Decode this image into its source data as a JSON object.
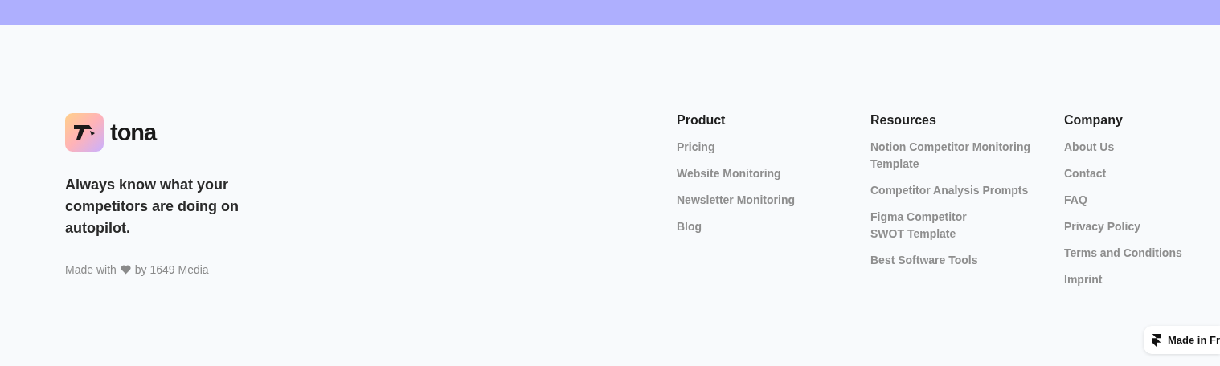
{
  "brand": {
    "name": "tona"
  },
  "tagline": "Always know what your competitors are doing on autopilot.",
  "credit": {
    "before": "Made with",
    "after": "by 1649 Media"
  },
  "columns": [
    {
      "title": "Product",
      "links": [
        "Pricing",
        "Website Monitoring",
        "Newsletter Monitoring",
        "Blog"
      ]
    },
    {
      "title": "Resources",
      "links": [
        "Notion Competitor Monitoring Template",
        "Competitor Analysis Prompts",
        "Figma Competitor\nSWOT Template",
        "Best Software Tools"
      ]
    },
    {
      "title": "Company",
      "links": [
        "About Us",
        "Contact",
        "FAQ",
        "Privacy Policy",
        "Terms and Conditions",
        "Imprint"
      ]
    }
  ],
  "badge": {
    "label": "Made in Fr"
  }
}
